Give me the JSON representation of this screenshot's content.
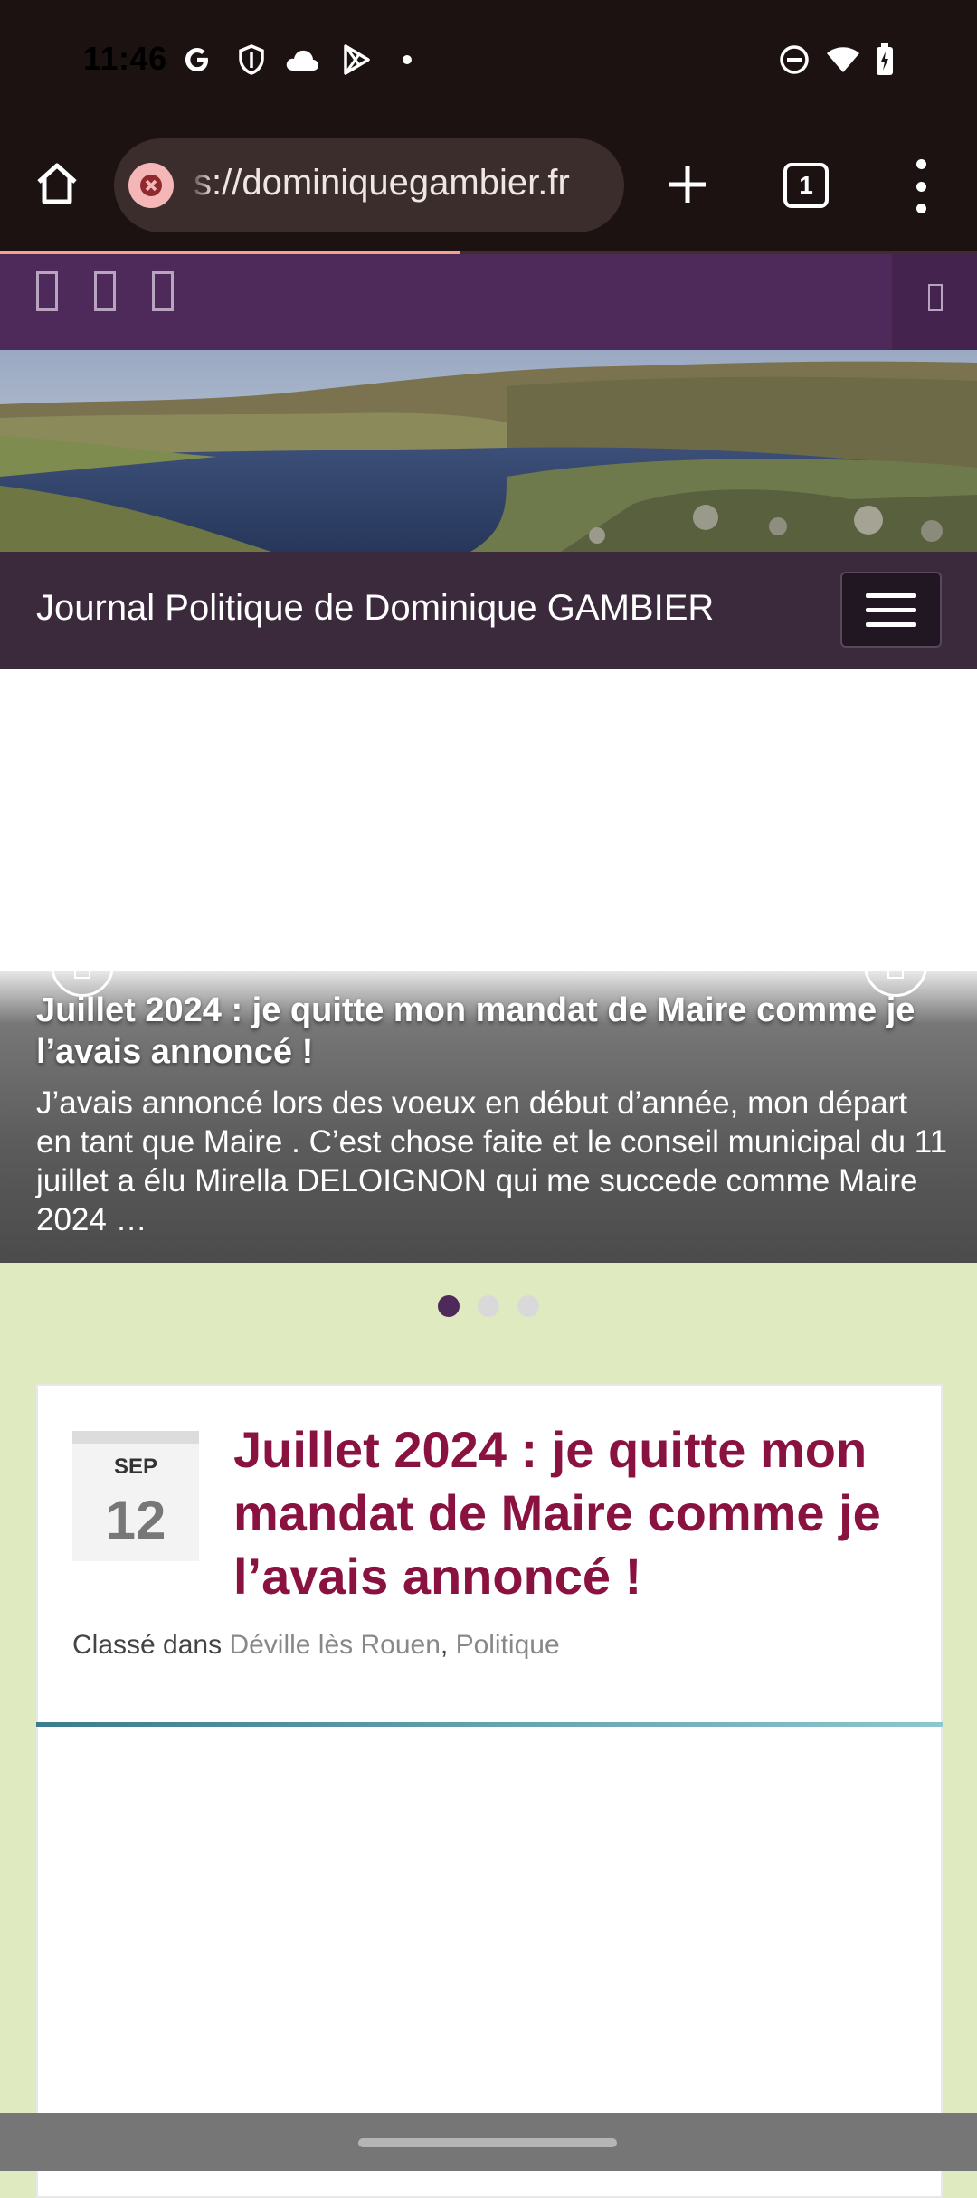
{
  "status_bar": {
    "time": "11:46",
    "left_icons": [
      "google-icon",
      "shield-icon",
      "cloud-icon",
      "play-store-icon",
      "dot-icon"
    ],
    "right_icons": [
      "do-not-disturb-icon",
      "wifi-icon",
      "battery-charging-icon"
    ]
  },
  "browser": {
    "url": "s://dominiquegambier.fr",
    "tab_count": "1",
    "page_load_progress": 0.47
  },
  "site": {
    "title": "Journal Politique de Dominique GAMBIER"
  },
  "slider": {
    "title": "Juillet 2024 : je quitte mon mandat de Maire comme je l’avais annoncé !",
    "excerpt": "J’avais annoncé lors des voeux en début d’année, mon départ en tant que Maire . C’est chose faite et le conseil municipal du 11 juillet a élu Mirella DELOIGNON qui me succede comme Maire 2024 …",
    "dots_total": 3,
    "active_dot": 1
  },
  "article": {
    "date_month": "SEP",
    "date_day": "12",
    "title": "Juillet 2024 : je quitte mon mandat de Maire comme je l’avais annoncé !",
    "meta_prefix": "Classé dans",
    "categories": [
      "Déville lès Rouen",
      "Politique"
    ],
    "separator": ", "
  },
  "colors": {
    "top_bar": "#4d2a5a",
    "header": "#3a2a3c",
    "page_bg": "#dfeac1",
    "article_title": "#8a1240",
    "active_dot": "#4d2a5a"
  }
}
